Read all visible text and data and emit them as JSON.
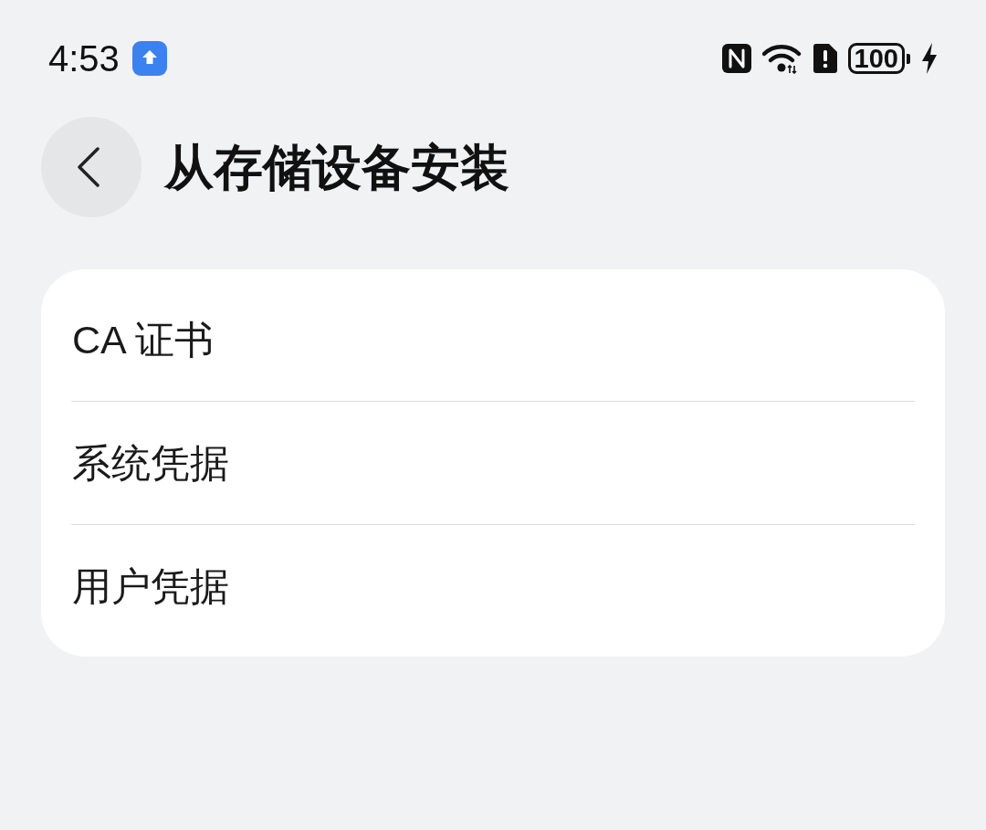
{
  "status_bar": {
    "time": "4:53",
    "battery": "100"
  },
  "header": {
    "title": "从存储设备安装"
  },
  "items": [
    {
      "label": "CA 证书"
    },
    {
      "label": "系统凭据"
    },
    {
      "label": "用户凭据"
    }
  ]
}
